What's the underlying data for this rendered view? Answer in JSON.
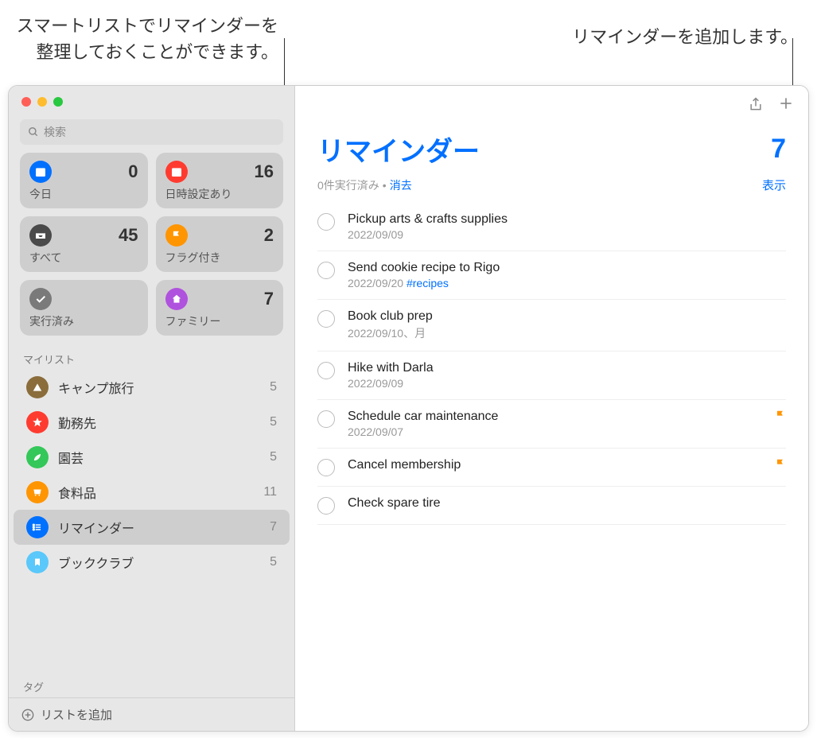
{
  "callouts": {
    "smartlist": "スマートリストでリマインダーを\n整理しておくことができます。",
    "add": "リマインダーを追加します。"
  },
  "search": {
    "placeholder": "検索"
  },
  "smartlists": [
    {
      "label": "今日",
      "count": 0,
      "color": "#0070ff",
      "icon": "calendar"
    },
    {
      "label": "日時設定あり",
      "count": 16,
      "color": "#ff3b30",
      "icon": "calendar"
    },
    {
      "label": "すべて",
      "count": 45,
      "color": "#4a4a4a",
      "icon": "tray"
    },
    {
      "label": "フラグ付き",
      "count": 2,
      "color": "#ff9500",
      "icon": "flag"
    },
    {
      "label": "実行済み",
      "count": "",
      "color": "#7a7a7a",
      "icon": "check"
    },
    {
      "label": "ファミリー",
      "count": 7,
      "color": "#af52de",
      "icon": "home"
    }
  ],
  "sections": {
    "mylists": "マイリスト",
    "tags": "タグ"
  },
  "mylists": [
    {
      "name": "キャンプ旅行",
      "count": 5,
      "color": "#8a6d3b",
      "icon": "tent"
    },
    {
      "name": "勤務先",
      "count": 5,
      "color": "#ff3b30",
      "icon": "star"
    },
    {
      "name": "園芸",
      "count": 5,
      "color": "#34c759",
      "icon": "leaf"
    },
    {
      "name": "食料品",
      "count": 11,
      "color": "#ff9500",
      "icon": "cart"
    },
    {
      "name": "リマインダー",
      "count": 7,
      "color": "#0070ff",
      "icon": "list",
      "selected": true
    },
    {
      "name": "ブッククラブ",
      "count": 5,
      "color": "#5ac8fa",
      "icon": "bookmark"
    }
  ],
  "addlist": "リストを追加",
  "main": {
    "title": "リマインダー",
    "count": 7,
    "completed": "0件実行済み",
    "clear": "消去",
    "show": "表示"
  },
  "reminders": [
    {
      "title": "Pickup arts & crafts supplies",
      "date": "2022/09/09"
    },
    {
      "title": "Send cookie recipe to Rigo",
      "date": "2022/09/20",
      "tag": "#recipes"
    },
    {
      "title": "Book club prep",
      "date": "2022/09/10、月"
    },
    {
      "title": "Hike with Darla",
      "date": "2022/09/09"
    },
    {
      "title": "Schedule car maintenance",
      "date": "2022/09/07",
      "flagged": true
    },
    {
      "title": "Cancel membership",
      "flagged": true
    },
    {
      "title": "Check spare tire"
    }
  ]
}
